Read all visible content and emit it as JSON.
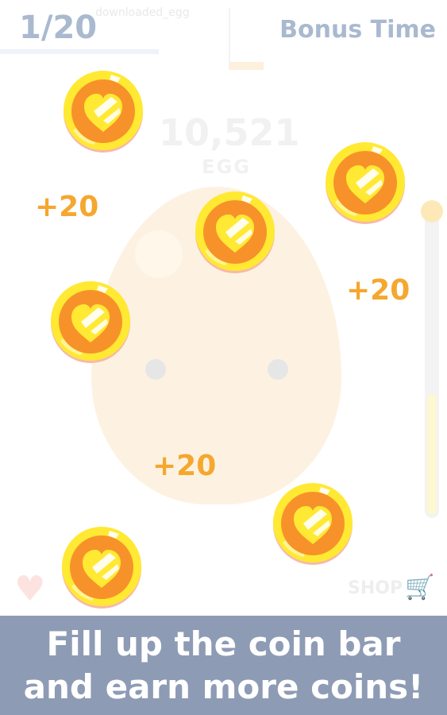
{
  "hud": {
    "progress": "1/20",
    "bonus_label": "Bonus Time"
  },
  "background": {
    "file_label": "downloaded_egg",
    "count": "10,521",
    "count_unit": "EGG",
    "shop_label": "SHOP",
    "coin_bar_level": 0.4
  },
  "popups": [
    {
      "text": "+20"
    },
    {
      "text": "+20"
    },
    {
      "text": "+20"
    }
  ],
  "coins": [
    {
      "icon": "heart-coin-icon"
    },
    {
      "icon": "heart-coin-icon"
    },
    {
      "icon": "heart-coin-icon"
    },
    {
      "icon": "heart-coin-icon"
    },
    {
      "icon": "heart-coin-icon"
    },
    {
      "icon": "heart-coin-icon"
    }
  ],
  "banner": {
    "line1": "Fill up the coin bar",
    "line2": "and earn more coins!"
  },
  "colors": {
    "coin_outer": "#ffe933",
    "coin_inner": "#f7922a",
    "popup_text": "#f5a72f",
    "hud_text": "#a9b9cf",
    "banner_bg": "#8e9bb5"
  }
}
